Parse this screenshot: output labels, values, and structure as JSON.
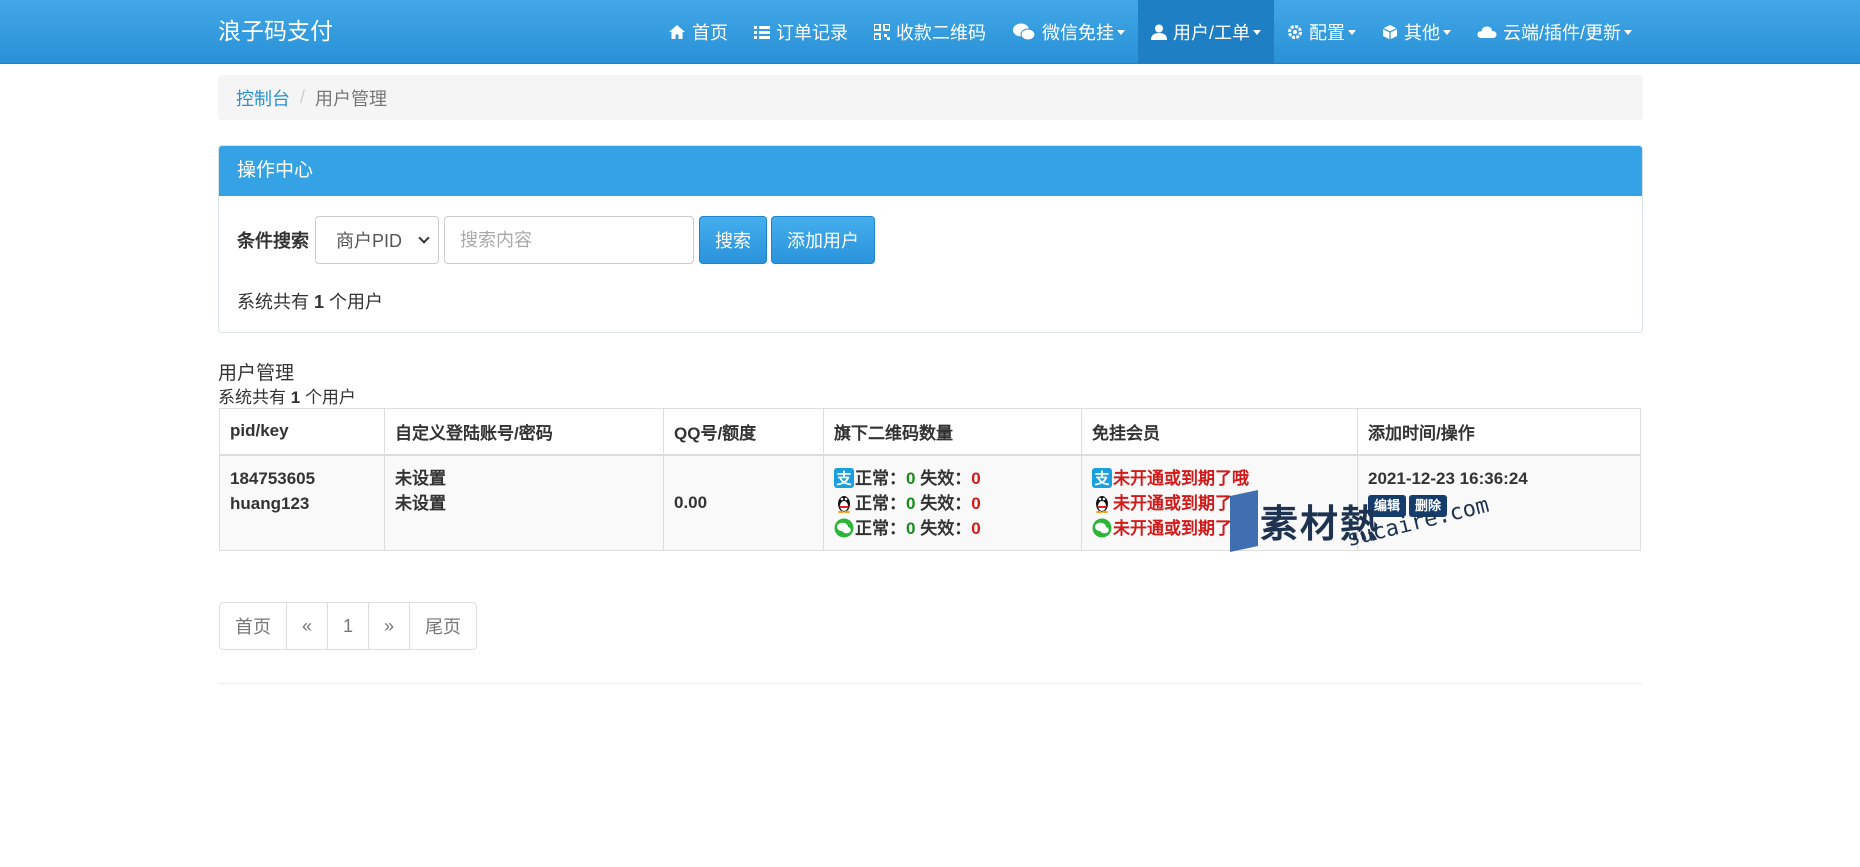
{
  "brand": "浪子码支付",
  "nav": {
    "items": [
      {
        "label": "首页",
        "icon": "home-icon",
        "caret": false
      },
      {
        "label": "订单记录",
        "icon": "list-icon",
        "caret": false
      },
      {
        "label": "收款二维码",
        "icon": "qrcode-icon",
        "caret": false
      },
      {
        "label": "微信免挂",
        "icon": "wechat-icon",
        "caret": true
      },
      {
        "label": "用户/工单",
        "icon": "user-icon",
        "caret": true,
        "active": true
      },
      {
        "label": "配置",
        "icon": "gear-icon",
        "caret": true
      },
      {
        "label": "其他",
        "icon": "cube-icon",
        "caret": true
      },
      {
        "label": "云端/插件/更新",
        "icon": "cloud-icon",
        "caret": true
      }
    ]
  },
  "breadcrumb": {
    "home": "控制台",
    "separator": "/",
    "current": "用户管理"
  },
  "panel": {
    "heading": "操作中心",
    "search_label": "条件搜索",
    "select_value": "商户PID",
    "search_placeholder": "搜索内容",
    "search_button": "搜索",
    "add_button": "添加用户",
    "count_prefix": "系统共有",
    "count_value": "1",
    "count_suffix": "个用户"
  },
  "table": {
    "title": "用户管理",
    "sub_prefix": "系统共有",
    "sub_value": "1",
    "sub_suffix": "个用户",
    "headers": [
      "pid/key",
      "自定义登陆账号/密码",
      "QQ号/额度",
      "旗下二维码数量",
      "免挂会员",
      "添加时间/操作"
    ],
    "row": {
      "pid": "184753605",
      "key": "huang123",
      "account": "未设置",
      "password": "未设置",
      "quota": "0.00",
      "qr": [
        {
          "channel": "alipay",
          "ok_label": "正常：",
          "ok": "0",
          "bad_label": "失效：",
          "bad": "0"
        },
        {
          "channel": "qq",
          "ok_label": "正常：",
          "ok": "0",
          "bad_label": "失效：",
          "bad": "0"
        },
        {
          "channel": "wechat",
          "ok_label": "正常：",
          "ok": "0",
          "bad_label": "失效：",
          "bad": "0"
        }
      ],
      "member": [
        "未开通或到期了哦",
        "未开通或到期了",
        "未开通或到期了"
      ],
      "time": "2021-12-23 16:36:24",
      "edit": "编辑",
      "delete": "删除"
    }
  },
  "watermark": {
    "main": "素材熱",
    "url": "sucaire.com"
  },
  "pager": {
    "first": "首页",
    "prev": "«",
    "page": "1",
    "next": "»",
    "last": "尾页"
  },
  "colors": {
    "primary": "#35a2e5",
    "ok": "#1a8a1a",
    "bad": "#d11a1a",
    "dark_button": "#153c6b"
  }
}
